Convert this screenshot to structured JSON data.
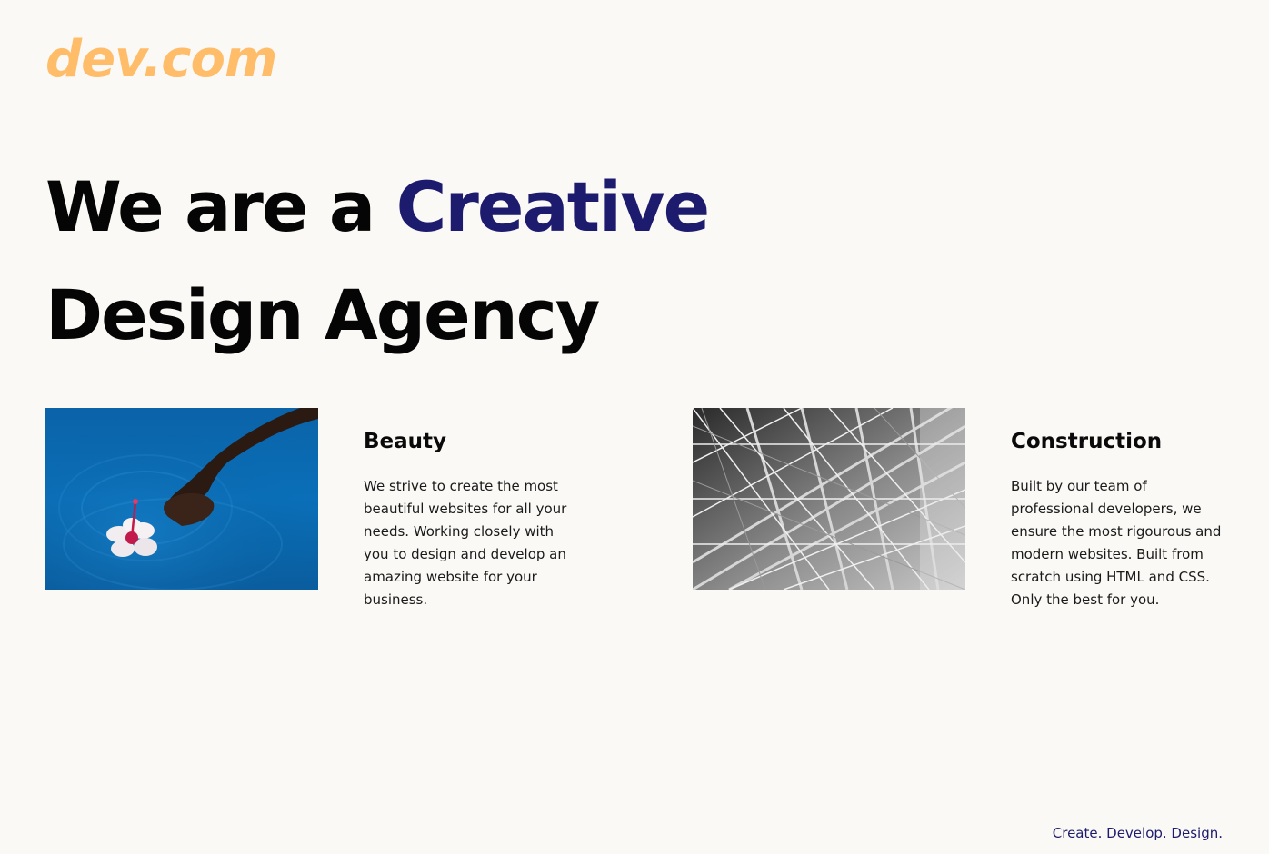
{
  "brand": {
    "logo": "dev.com",
    "logo_color": "#ffbd69"
  },
  "hero": {
    "line1_prefix": "We are a ",
    "line1_accent": "Creative",
    "line2": "Design Agency",
    "accent_color": "#1d1b6e"
  },
  "cards": [
    {
      "image": "hand-touching-water-with-flower-photo",
      "title": "Beauty",
      "text": "We strive to create the most beautiful websites for all your needs. Working closely with you to design and develop an amazing website for your business."
    },
    {
      "image": "steel-lattice-structure-photo",
      "title": "Construction",
      "text": "Built by our team of professional developers, we ensure the most rigourous and modern websites. Built from scratch using HTML and CSS. Only the best for you."
    }
  ],
  "footer": {
    "tagline": "Create. Develop. Design."
  }
}
